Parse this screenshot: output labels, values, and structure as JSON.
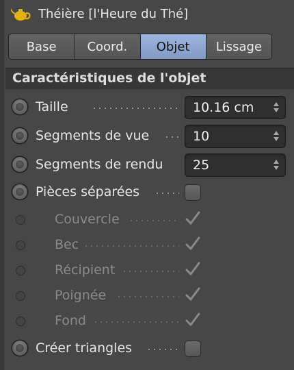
{
  "window": {
    "title": "Théière [l'Heure du Thé]",
    "icon": "teapot-icon",
    "accent_color": "#e3b30b"
  },
  "tabs": [
    {
      "label": "Base",
      "active": false
    },
    {
      "label": "Coord.",
      "active": false
    },
    {
      "label": "Objet",
      "active": true
    },
    {
      "label": "Lissage",
      "active": false
    }
  ],
  "section": {
    "title": "Caractéristiques de l'objet"
  },
  "params": {
    "taille": {
      "label": "Taille",
      "value": "10.16 cm"
    },
    "segments_vue": {
      "label": "Segments de vue",
      "value": "10"
    },
    "segments_rendu": {
      "label": "Segments de rendu",
      "value": "25"
    },
    "pieces_separees": {
      "label": "Pièces séparées",
      "checked": false
    },
    "couvercle": {
      "label": "Couvercle",
      "checked": true,
      "enabled": false
    },
    "bec": {
      "label": "Bec",
      "checked": true,
      "enabled": false
    },
    "recipient": {
      "label": "Récipient",
      "checked": true,
      "enabled": false
    },
    "poignee": {
      "label": "Poignée",
      "checked": true,
      "enabled": false
    },
    "fond": {
      "label": "Fond",
      "checked": true,
      "enabled": false
    },
    "creer_triangles": {
      "label": "Créer triangles",
      "checked": false
    }
  }
}
